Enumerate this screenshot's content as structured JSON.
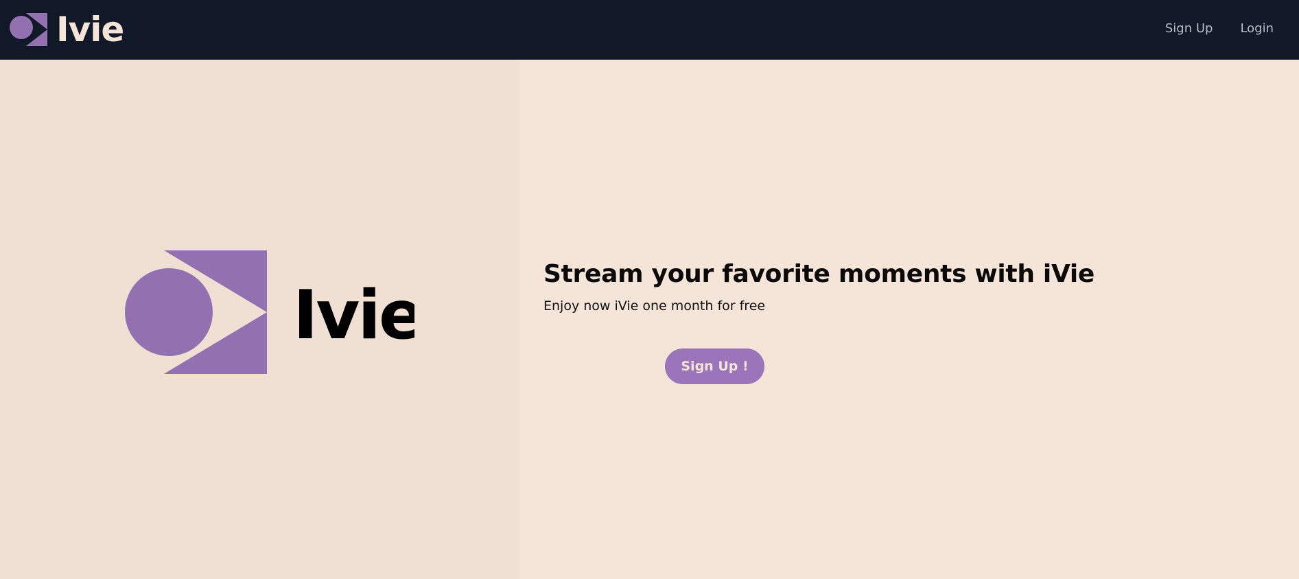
{
  "brand": {
    "name": "Ivie",
    "colors": {
      "purple": "#9370b0",
      "navbar": "#111827",
      "cream": "#f5e5d9",
      "left_panel": "#f0dfd3"
    }
  },
  "navbar": {
    "logo_icon": "circle-play-triangle-logo",
    "logo_text": "Ivie",
    "links": [
      {
        "label": "Sign Up"
      },
      {
        "label": "Login"
      }
    ]
  },
  "hero": {
    "logo_icon": "circle-play-triangle-logo",
    "logo_text": "Ivie",
    "headline": "Stream your favorite moments with iVie",
    "subline": "Enjoy now iVie one month for free",
    "cta_label": "Sign Up !"
  }
}
